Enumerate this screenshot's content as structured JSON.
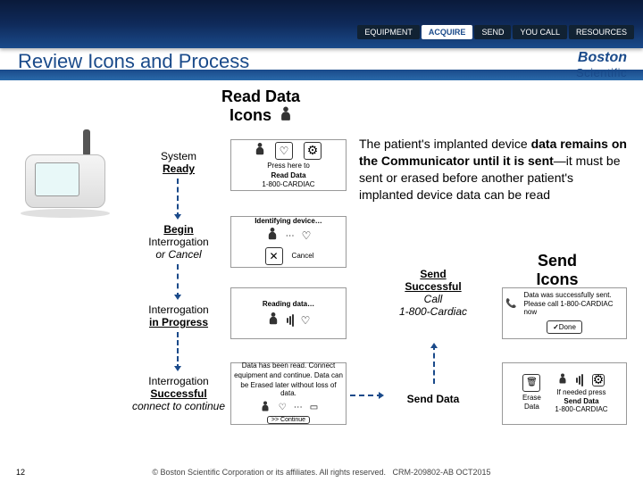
{
  "nav": {
    "items": [
      {
        "label": "EQUIPMENT"
      },
      {
        "label": "ACQUIRE"
      },
      {
        "label": "SEND"
      },
      {
        "label": "YOU CALL"
      },
      {
        "label": "RESOURCES"
      }
    ]
  },
  "title": "Review Icons and Process",
  "brand": {
    "l1": "Boston",
    "l2": "Scientific"
  },
  "read_heading": "Read Data Icons",
  "steps": {
    "s1a": "System",
    "s1b": "Ready",
    "s2a": "Begin",
    "s2b": "Interrogation",
    "s2c": "or Cancel",
    "s3a": "Interrogation",
    "s3b": "in Progress",
    "s4a": "Interrogation",
    "s4b": "Successful",
    "s4c": "connect to continue"
  },
  "screens": {
    "ready": {
      "line1": "Press here to",
      "line2": "Read Data",
      "line3": "1-800-CARDIAC"
    },
    "identify": {
      "title": "Identifying device…",
      "cancel": "Cancel"
    },
    "reading": {
      "title": "Reading data…"
    },
    "done": {
      "line1": "Data has been read. Connect",
      "line2": "equipment and continue. Data can",
      "line3": "be Erased later without loss of data.",
      "btn": ">> Continue"
    },
    "sent": {
      "line1": "Data was successfully sent.",
      "line2": "Please call 1-800-CARDIAC now",
      "btn": "Done"
    },
    "erase": {
      "left_l1": "Erase",
      "left_l2": "Data",
      "right_l1": "If needed press",
      "right_l2": "Send Data",
      "right_l3": "1-800-CARDIAC"
    }
  },
  "explain": {
    "pre": "The patient's implanted device ",
    "bold": "data remains on the Communicator until it is sent",
    "post": "—it must be sent or erased before another patient's implanted device data can be read"
  },
  "send_heading": "Send Icons",
  "send_call": {
    "l1": "Send",
    "l2": "Successful",
    "l3": "Call",
    "l4": "1-800-Cardiac"
  },
  "send_data": "Send Data",
  "footer": {
    "copyright": "© Boston Scientific Corporation or its affiliates.  All rights reserved.",
    "doc": "CRM-209802-AB OCT2015"
  },
  "page": "12"
}
